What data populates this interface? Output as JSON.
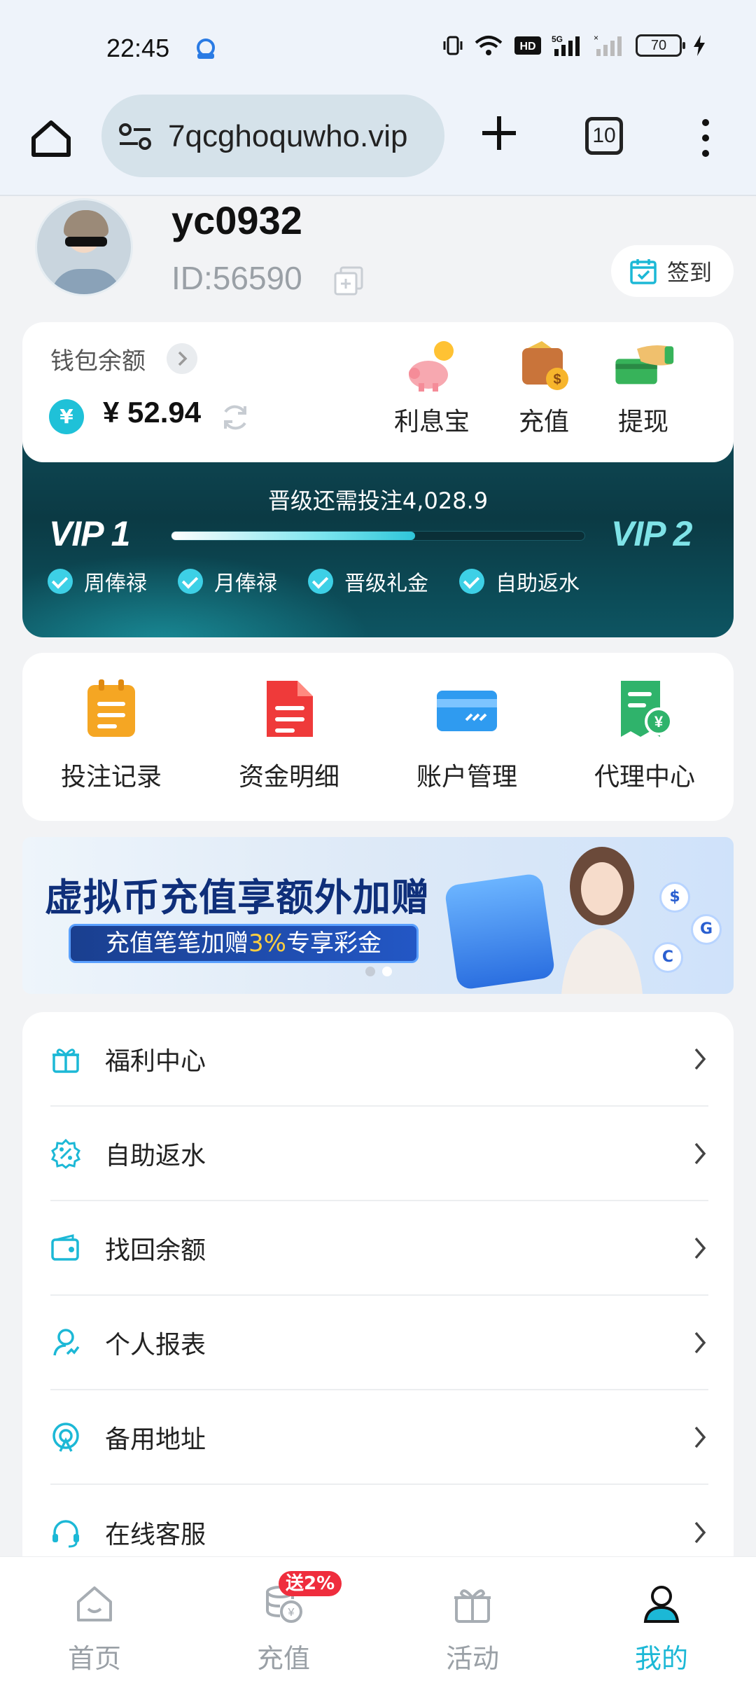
{
  "status_bar": {
    "time": "22:45",
    "battery": "70"
  },
  "browser": {
    "url": "7qcghoquwho.vip",
    "tab_count": "10"
  },
  "profile": {
    "username": "yc0932",
    "id_text": "ID:56590",
    "signin_label": "签到"
  },
  "wallet": {
    "label": "钱包余额",
    "currency_symbol": "¥",
    "balance": "¥ 52.94",
    "actions": [
      {
        "label": "利息宝",
        "icon": "piggy-bank-icon"
      },
      {
        "label": "充值",
        "icon": "wallet-deposit-icon"
      },
      {
        "label": "提现",
        "icon": "cash-withdraw-icon"
      }
    ]
  },
  "vip": {
    "progress_text": "晋级还需投注4,028.9",
    "current_level": "VIP 1",
    "next_level": "VIP 2",
    "progress_fraction": 0.59,
    "perks": [
      "周俸禄",
      "月俸禄",
      "晋级礼金",
      "自助返水"
    ]
  },
  "quick_actions": [
    {
      "label": "投注记录",
      "icon": "clipboard-icon",
      "color": "#f5a623"
    },
    {
      "label": "资金明细",
      "icon": "document-icon",
      "color": "#ef3a3a"
    },
    {
      "label": "账户管理",
      "icon": "card-icon",
      "color": "#2f9bf0"
    },
    {
      "label": "代理中心",
      "icon": "agent-receipt-icon",
      "color": "#2fb36b"
    }
  ],
  "banner": {
    "title": "虚拟币充值享额外加赠",
    "subtitle_prefix": "充值笔笔加赠",
    "subtitle_highlight": "3%",
    "subtitle_suffix": "专享彩金",
    "active_slide": 2,
    "slide_count": 2
  },
  "menu": [
    {
      "label": "福利中心",
      "icon": "gift-icon"
    },
    {
      "label": "自助返水",
      "icon": "rebate-icon"
    },
    {
      "label": "找回余额",
      "icon": "wallet-recover-icon"
    },
    {
      "label": "个人报表",
      "icon": "report-user-icon"
    },
    {
      "label": "备用地址",
      "icon": "backup-address-icon"
    },
    {
      "label": "在线客服",
      "icon": "headset-icon"
    }
  ],
  "bottom_nav": [
    {
      "label": "首页",
      "icon": "home-icon"
    },
    {
      "label": "充值",
      "icon": "coins-icon",
      "badge": "送2%"
    },
    {
      "label": "活动",
      "icon": "gift-icon"
    },
    {
      "label": "我的",
      "icon": "user-icon",
      "active": true
    }
  ],
  "colors": {
    "accent": "#1cb8d6",
    "vip_card_bg": "#0f4a57",
    "badge_red": "#ef2d3d"
  }
}
